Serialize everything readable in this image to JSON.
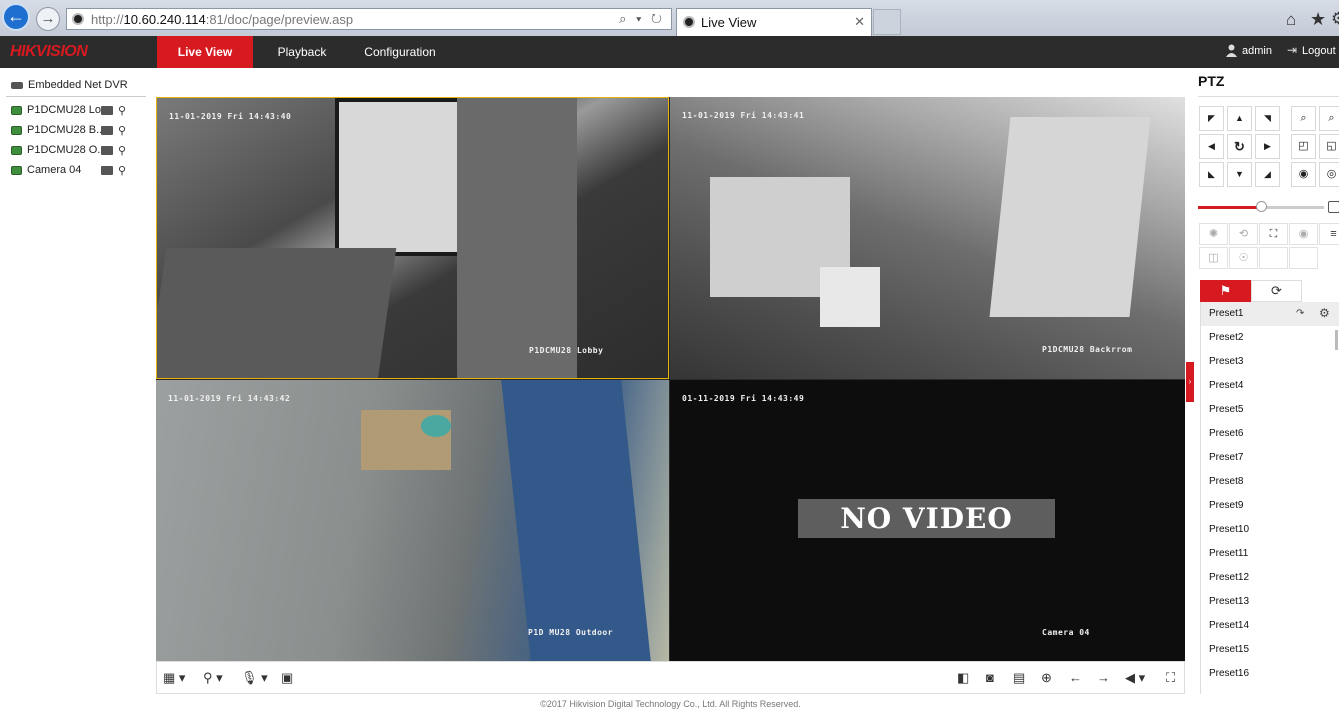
{
  "browser": {
    "url_scheme": "http://",
    "url_host": "10.60.240.114",
    "url_rest": ":81/doc/page/preview.asp",
    "addr_icons": "⌕ ▾ ↻",
    "tab_title": "Live View",
    "tab_close": "✕",
    "back_glyph": "←",
    "fwd_glyph": "→",
    "home_glyph": "⌂",
    "star_glyph": "★",
    "gear_glyph": "⚙"
  },
  "header": {
    "logo": "HIKVISION",
    "nav": [
      "Live View",
      "Playback",
      "Configuration"
    ],
    "user": "admin",
    "logout": "Logout",
    "logout_glyph": "⇥"
  },
  "device_tree": {
    "root": "Embedded Net DVR",
    "cameras": [
      "P1DCMU28 Lo...",
      "P1DCMU28 B...",
      "P1DCMU28 O...",
      "Camera 04"
    ],
    "ptz_glyph": "⚲"
  },
  "video": {
    "tiles": [
      {
        "timestamp": "11-01-2019 Fri 14:43:40",
        "name": "P1DCMU28 Lobby"
      },
      {
        "timestamp": "11-01-2019 Fri 14:43:41",
        "name": "P1DCMU28 Backrrom"
      },
      {
        "timestamp": "11-01-2019 Fri 14:43:42",
        "name": "P1D MU28 Outdoor"
      },
      {
        "timestamp": "01-11-2019 Fri 14:43:49",
        "name": "Camera 04"
      }
    ],
    "no_video": "NO VIDEO"
  },
  "toolbar": {
    "layout_glyph": "▦ ▾",
    "stream_glyph": "⚲ ▾",
    "mic_glyph": "🎙 ▾",
    "view_glyph": "▣",
    "stop_all_glyph": "◧",
    "capture_glyph": "◙",
    "record_glyph": "▤",
    "zoom_glyph": "⊕",
    "prev_glyph": "←",
    "next_glyph": "→",
    "volume_glyph": "◀ ▾",
    "fullscreen_glyph": "⛶"
  },
  "footer": "©2017 Hikvision Digital Technology Co., Ltd. All Rights Reserved.",
  "ptz": {
    "title": "PTZ",
    "glyphs": {
      "dir": [
        "◤",
        "▲",
        "◥",
        "◀",
        "↻",
        "▶",
        "◣",
        "▼",
        "◢"
      ],
      "zoom": [
        "⌕",
        "⌕",
        "◰",
        "◱",
        "◉",
        "◎"
      ],
      "func": [
        "✺",
        "⟲",
        "⛶",
        "◉",
        "≡",
        "◫",
        "☉"
      ],
      "preset_tab": "⚑",
      "patrol_tab": "⟳",
      "goto": "↷",
      "gear": "⚙"
    },
    "speed_fraction": 0.5,
    "presets": [
      "Preset1",
      "Preset2",
      "Preset3",
      "Preset4",
      "Preset5",
      "Preset6",
      "Preset7",
      "Preset8",
      "Preset9",
      "Preset10",
      "Preset11",
      "Preset12",
      "Preset13",
      "Preset14",
      "Preset15",
      "Preset16"
    ],
    "accent": "#d71920"
  }
}
